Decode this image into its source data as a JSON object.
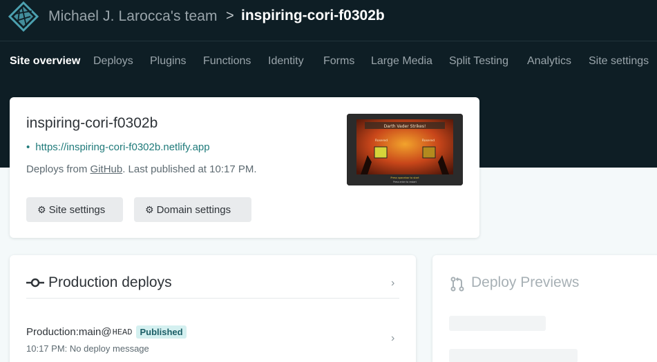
{
  "header": {
    "team_name": "Michael J. Larocca's team",
    "separator": ">",
    "site_name": "inspiring-cori-f0302b",
    "logo_icon": "netlify-logo-icon"
  },
  "nav": {
    "items": [
      {
        "label": "Site overview",
        "active": true
      },
      {
        "label": "Deploys"
      },
      {
        "label": "Plugins"
      },
      {
        "label": "Functions"
      },
      {
        "label": "Identity"
      },
      {
        "label": "Forms"
      },
      {
        "label": "Large Media"
      },
      {
        "label": "Split Testing"
      },
      {
        "label": "Analytics"
      },
      {
        "label": "Site settings"
      }
    ]
  },
  "site_card": {
    "title": "inspiring-cori-f0302b",
    "url": "https://inspiring-cori-f0302b.netlify.app",
    "deploy_prefix": "Deploys from ",
    "deploy_source": "GitHub",
    "deploy_suffix": ". Last published at 10:17 PM.",
    "site_settings_label": "Site settings",
    "domain_settings_label": "Domain settings",
    "thumbnail": {
      "heading": "Darth Vader Strikes!",
      "left_label": "Rosered",
      "right_label": "Rosered",
      "footer_line1": "Press spacebar to start",
      "footer_line2": "Press enter to restart"
    }
  },
  "production": {
    "title": "Production deploys",
    "row_label": "Production: ",
    "branch": "main@",
    "ref": "HEAD",
    "status": "Published",
    "message": "10:17 PM: No deploy message"
  },
  "previews": {
    "title": "Deploy Previews"
  },
  "colors": {
    "header_bg": "#0e1e25",
    "accent_teal": "#1f7a7a",
    "badge_bg": "#d4f0f0",
    "logo": "#4ca1b0"
  }
}
